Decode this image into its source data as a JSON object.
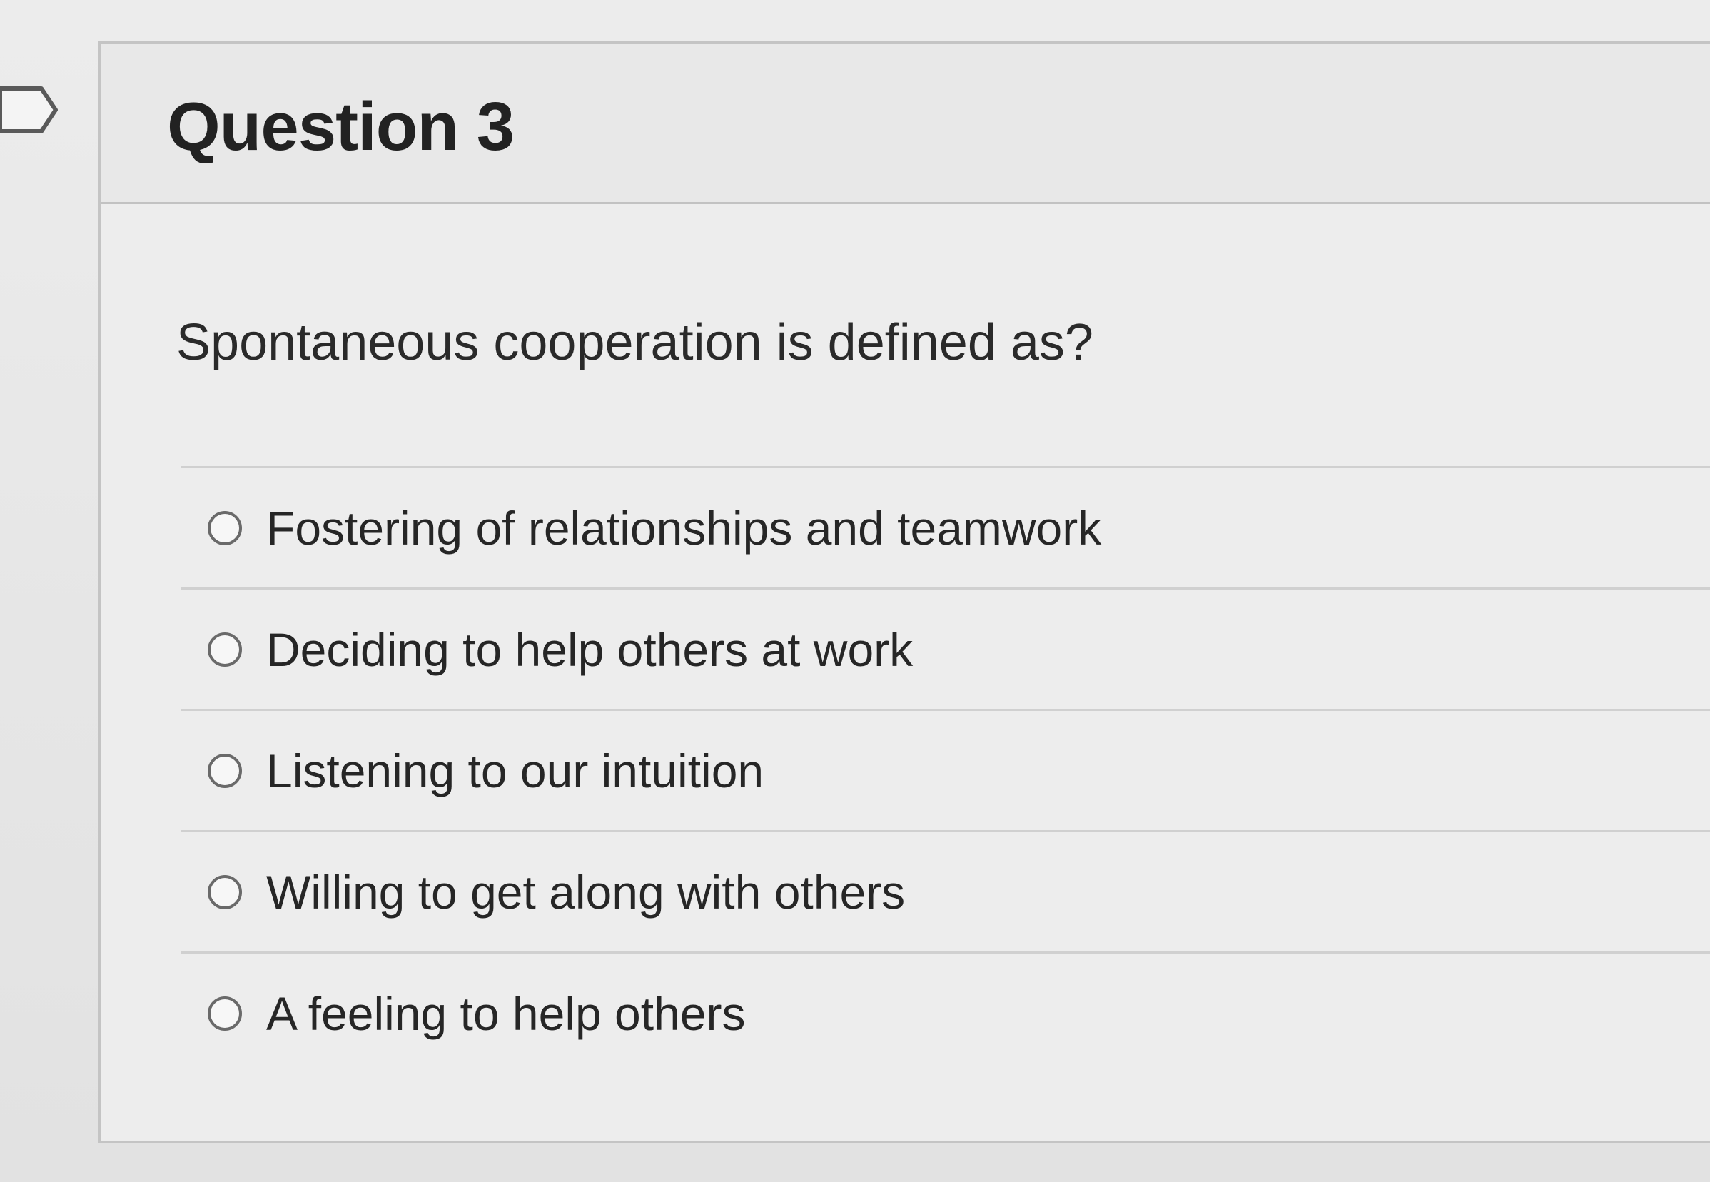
{
  "question": {
    "title": "Question 3",
    "prompt": "Spontaneous cooperation is defined as?",
    "options": [
      {
        "label": "Fostering of relationships and teamwork",
        "selected": false
      },
      {
        "label": "Deciding to help others at work",
        "selected": false
      },
      {
        "label": "Listening to our intuition",
        "selected": false
      },
      {
        "label": "Willing to get along with others",
        "selected": false
      },
      {
        "label": "A feeling to help others",
        "selected": false
      }
    ]
  },
  "icons": {
    "flag": "bookmark-flag-icon",
    "option_marker": "radio-button-icon"
  },
  "colors": {
    "background": "#e9e9e9",
    "text": "#222222",
    "border": "#c4c4c4",
    "radio": "#6a6a6a"
  }
}
